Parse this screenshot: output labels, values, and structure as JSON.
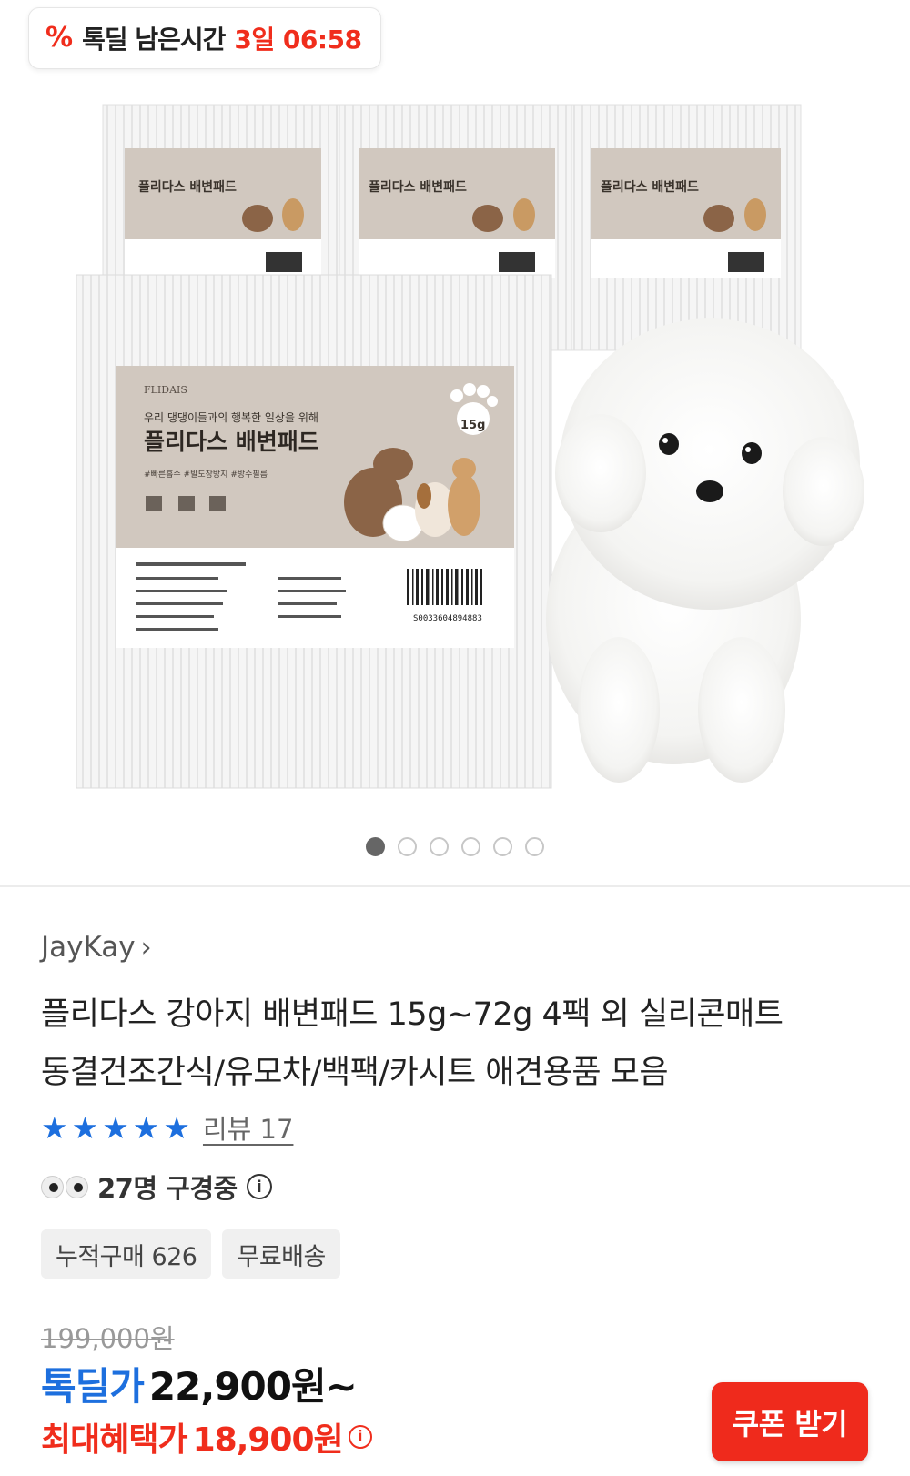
{
  "timer": {
    "icon": "percent-icon",
    "label": "톡딜 남은시간",
    "time": "3일 06:58"
  },
  "product_image": {
    "package_brand": "FLIDAIS",
    "package_subtitle": "우리 댕댕이들과의 행복한 일상을 위해",
    "package_title": "플리다스 배변패드",
    "package_weight": "15g",
    "package_tags": "#빠른흡수 #발도장방지 #방수필름",
    "barcode_number": "S0033604894883"
  },
  "carousel": {
    "total": 6,
    "active_index": 0
  },
  "brand": {
    "name": "JayKay",
    "chevron": "›"
  },
  "title_lines": [
    "플리다스 강아지 배변패드 15g~72g 4팩 외 실리콘매트",
    "동결건조간식/유모차/백팩/카시트 애견용품 모음"
  ],
  "rating": {
    "stars": 5,
    "star_color": "#1d6fde",
    "review_label": "리뷰 17"
  },
  "viewers": {
    "text": "27명 구경중",
    "info": "i"
  },
  "chips": [
    "누적구매 626",
    "무료배송"
  ],
  "price": {
    "original": "199,000원",
    "deal_label": "톡딜가",
    "deal_price": "22,900원~",
    "max_label": "최대혜택가",
    "max_price": "18,900원",
    "info": "i"
  },
  "coupon_button": {
    "label": "쿠폰 받기",
    "color": "#ef2a1c"
  },
  "colors": {
    "accent_red": "#f02d1c",
    "accent_blue": "#1d6fde"
  }
}
